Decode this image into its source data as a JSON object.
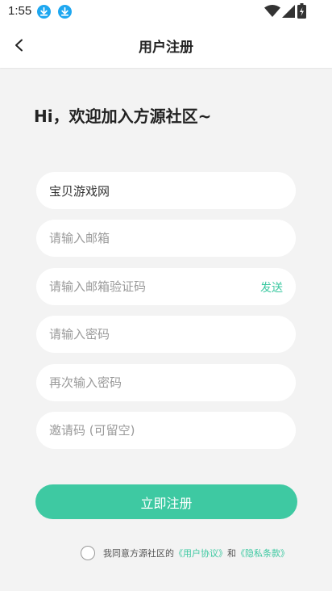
{
  "status_bar": {
    "time": "1:55"
  },
  "header": {
    "title": "用户注册"
  },
  "welcome": "Hi，欢迎加入方源社区~",
  "form": {
    "username": {
      "value": "宝贝游戏网",
      "placeholder": ""
    },
    "email": {
      "value": "",
      "placeholder": "请输入邮箱"
    },
    "email_code": {
      "value": "",
      "placeholder": "请输入邮箱验证码",
      "send_label": "发送"
    },
    "password": {
      "value": "",
      "placeholder": "请输入密码"
    },
    "password_confirm": {
      "value": "",
      "placeholder": "再次输入密码"
    },
    "invite_code": {
      "value": "",
      "placeholder": "邀请码 (可留空)"
    },
    "submit_label": "立即注册"
  },
  "agreement": {
    "prefix": "我同意方源社区的",
    "user_agreement": "《用户协议》",
    "and": "和",
    "privacy_policy": "《隐私条款》"
  },
  "colors": {
    "accent": "#3ec9a2",
    "background": "#f3f3f3",
    "download_icon": "#1ea7f0"
  },
  "icons": {
    "back": "arrow-left-icon",
    "download": "download-icon",
    "wifi": "wifi-icon",
    "signal": "signal-icon",
    "battery": "battery-icon"
  }
}
